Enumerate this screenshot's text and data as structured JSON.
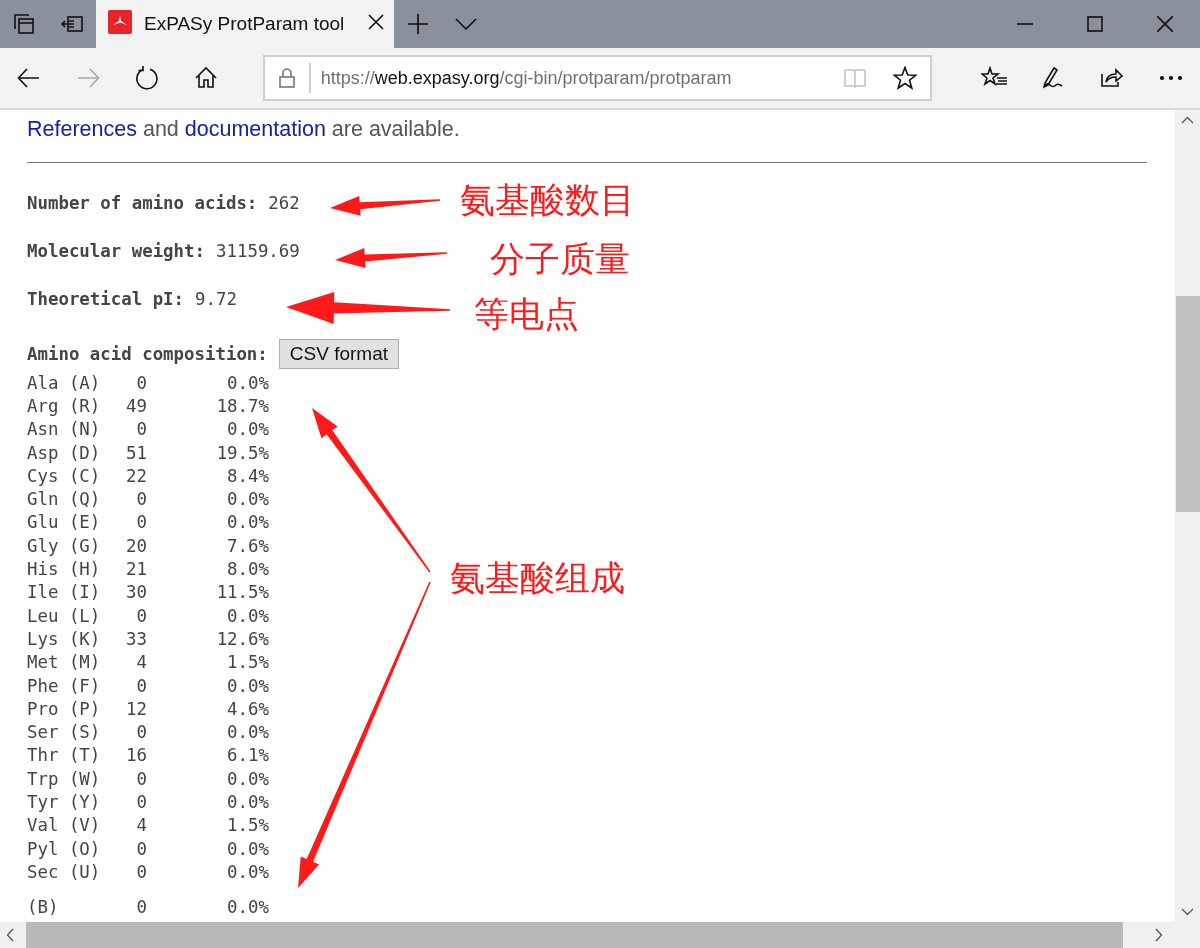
{
  "browser": {
    "tabs": [
      {
        "title": "ExPASy ProtParam tool",
        "selected": true
      }
    ],
    "forward_disabled": true,
    "address": {
      "scheme": "https://",
      "host": "web.expasy.org",
      "path": "/cgi-bin/protparam/protparam"
    }
  },
  "page": {
    "intro": [
      {
        "kind": "link",
        "text": "References"
      },
      {
        "kind": "text",
        "text": "and"
      },
      {
        "kind": "link",
        "text": "documentation"
      },
      {
        "kind": "text",
        "text": "are available."
      }
    ],
    "stats": [
      {
        "label": "Number of amino acids:",
        "value": "262"
      },
      {
        "label": "Molecular weight:",
        "value": "31159.69"
      },
      {
        "label": "Theoretical pI:",
        "value": "9.72"
      }
    ],
    "composition": {
      "label": "Amino acid composition:",
      "button": "CSV format",
      "rows": [
        {
          "name": "Ala (A)",
          "count": "0",
          "percent": "0.0%"
        },
        {
          "name": "Arg (R)",
          "count": "49",
          "percent": "18.7%"
        },
        {
          "name": "Asn (N)",
          "count": "0",
          "percent": "0.0%"
        },
        {
          "name": "Asp (D)",
          "count": "51",
          "percent": "19.5%"
        },
        {
          "name": "Cys (C)",
          "count": "22",
          "percent": "8.4%"
        },
        {
          "name": "Gln (Q)",
          "count": "0",
          "percent": "0.0%"
        },
        {
          "name": "Glu (E)",
          "count": "0",
          "percent": "0.0%"
        },
        {
          "name": "Gly (G)",
          "count": "20",
          "percent": "7.6%"
        },
        {
          "name": "His (H)",
          "count": "21",
          "percent": "8.0%"
        },
        {
          "name": "Ile (I)",
          "count": "30",
          "percent": "11.5%"
        },
        {
          "name": "Leu (L)",
          "count": "0",
          "percent": "0.0%"
        },
        {
          "name": "Lys (K)",
          "count": "33",
          "percent": "12.6%"
        },
        {
          "name": "Met (M)",
          "count": "4",
          "percent": "1.5%"
        },
        {
          "name": "Phe (F)",
          "count": "0",
          "percent": "0.0%"
        },
        {
          "name": "Pro (P)",
          "count": "12",
          "percent": "4.6%"
        },
        {
          "name": "Ser (S)",
          "count": "0",
          "percent": "0.0%"
        },
        {
          "name": "Thr (T)",
          "count": "16",
          "percent": "6.1%"
        },
        {
          "name": "Trp (W)",
          "count": "0",
          "percent": "0.0%"
        },
        {
          "name": "Tyr (Y)",
          "count": "0",
          "percent": "0.0%"
        },
        {
          "name": "Val (V)",
          "count": "4",
          "percent": "1.5%"
        },
        {
          "name": "Pyl (O)",
          "count": "0",
          "percent": "0.0%"
        },
        {
          "name": "Sec (U)",
          "count": "0",
          "percent": "0.0%"
        }
      ],
      "extra_rows": [
        {
          "name": "(B)",
          "count": "0",
          "percent": "0.0%"
        }
      ]
    }
  },
  "annotations": [
    {
      "label": "氨基酸数目"
    },
    {
      "label": "分子质量"
    },
    {
      "label": "等电点"
    },
    {
      "label": "氨基酸组成"
    }
  ]
}
